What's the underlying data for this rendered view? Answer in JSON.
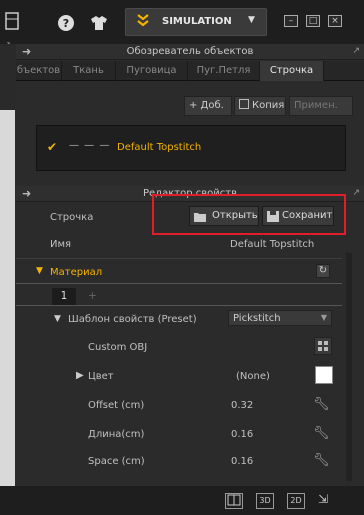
{
  "toolbar": {
    "simulation_label": "SIMULATION",
    "icons": [
      "layout-icon",
      "help-icon",
      "avatar-icon",
      "simulation-chevron-icon",
      "dropdown-icon"
    ],
    "window_buttons": [
      "minimize",
      "maximize",
      "close"
    ]
  },
  "object_browser": {
    "title": "Обозреватель объектов",
    "tabs": [
      "бъектов",
      "Ткань",
      "Пуговица",
      "Пуг.Петля",
      "Строчка"
    ],
    "active_tab": "Строчка",
    "actions": {
      "add": "+ Доб.",
      "copy": "Копия",
      "apply": "Примен."
    },
    "items": [
      {
        "name": "Default Topstitch",
        "selected": true,
        "line_style": "— — —"
      }
    ]
  },
  "property_editor": {
    "title": "Редактор свойств",
    "stitch_label": "Строчка",
    "open_button": "Открыть",
    "save_button": "Сохранит",
    "name_label": "Имя",
    "name_value": "Default Topstitch",
    "material_section": "Материал",
    "material_tab": "1",
    "material_tab_add": "+",
    "preset_label": "Шаблон свойств (Preset)",
    "preset_value": "Pickstitch",
    "custom_obj_label": "Custom OBJ",
    "color_label": "Цвет",
    "color_value": "(None)",
    "color_swatch": "#ffffff",
    "offset_label": "Offset (cm)",
    "offset_value": "0.32",
    "length_label": "Длина(cm)",
    "length_value": "0.16",
    "space_label": "Space (cm)",
    "space_value": "0.16"
  },
  "bottom_bar": {
    "view_3d": "3D",
    "view_2d": "2D"
  },
  "colors": {
    "accent": "#f5b301",
    "highlight": "#e01e2a",
    "bg": "#2b2b2b"
  }
}
